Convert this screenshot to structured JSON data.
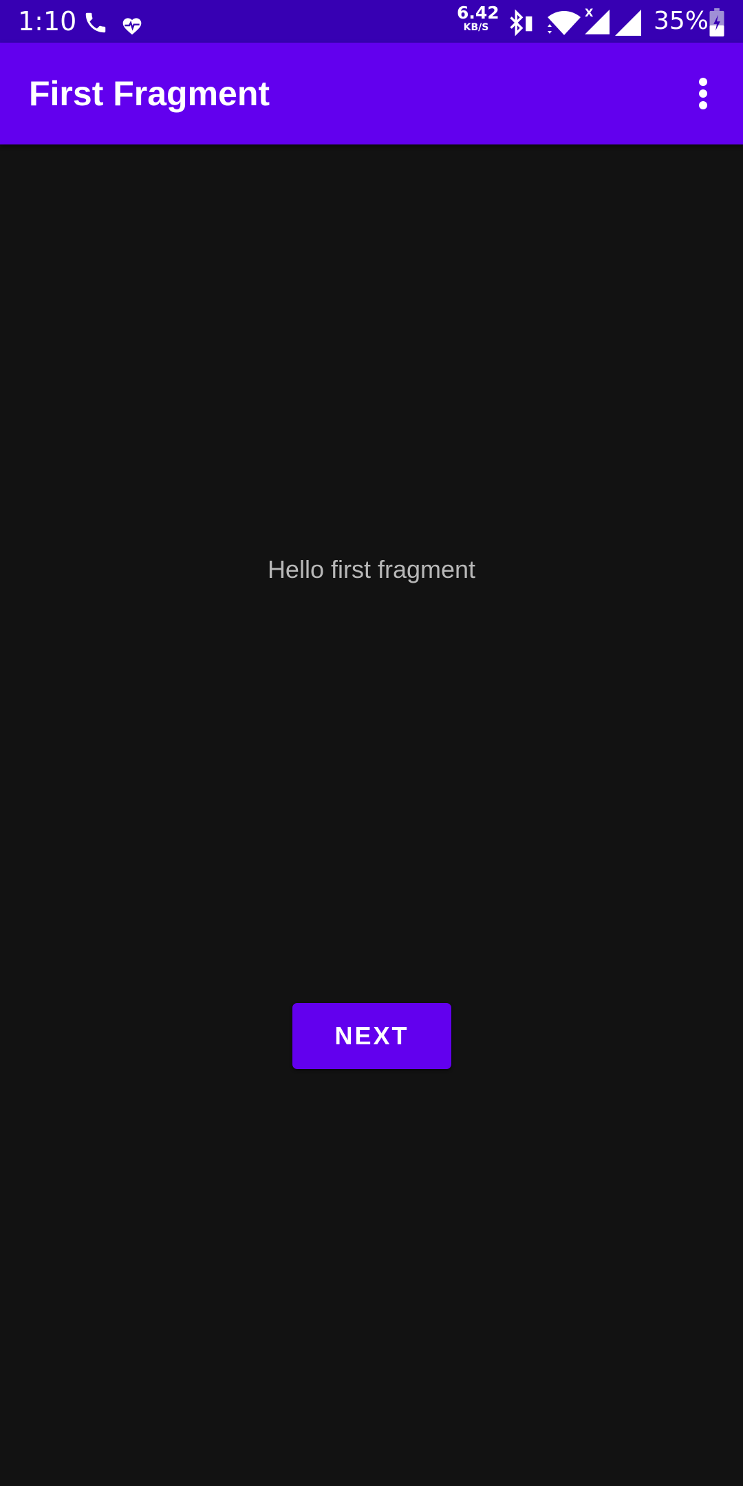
{
  "status_bar": {
    "time": "1:10",
    "net_speed_value": "6.42",
    "net_speed_unit": "KB/S",
    "battery_percent": "35%",
    "icons": [
      "phone-icon",
      "heart-pulse-icon",
      "bluetooth-icon",
      "wifi-icon",
      "signal-x-icon",
      "signal-icon",
      "battery-charging-icon"
    ],
    "background_color": "#3700b3"
  },
  "app_bar": {
    "title": "First Fragment",
    "overflow_icon": "more-vert-icon",
    "background_color": "#6200ee"
  },
  "content": {
    "message": "Hello first fragment",
    "next_label": "NEXT",
    "background_color": "#121212",
    "button_color": "#6200ee"
  }
}
